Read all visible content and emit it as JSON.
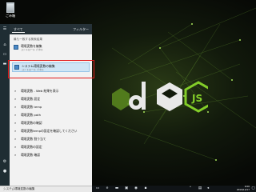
{
  "desktop": {
    "recycle_bin_label": "ごみ箱"
  },
  "search_panel": {
    "tabs": {
      "all": "すべて",
      "filter": "フィルター"
    },
    "section_best": "最も一致する検索結果",
    "best_match": [
      {
        "title": "環境変数を編集",
        "subtitle": "コントロール パネル"
      },
      {
        "title": "システム環境変数の編集",
        "subtitle": "コントロール パネル"
      }
    ],
    "suggestions": [
      {
        "text": "環境変数 - Web 結果を表示"
      },
      {
        "text": "環境変数 設定"
      },
      {
        "text": "環境変数 temp"
      },
      {
        "text": "環境変数 path"
      },
      {
        "text": "環境変数の確認"
      },
      {
        "text": "環境変数tempの設定を確認してください"
      },
      {
        "text": "環境変数 割り当て"
      },
      {
        "text": "環境変数の設定"
      },
      {
        "text": "環境変数 確認"
      }
    ],
    "search_query": "システム環境変数の編集"
  },
  "taskbar": {
    "time": "9:00",
    "date": "2019/12/17"
  },
  "colors": {
    "accent": "#e21b1b",
    "selection": "#cfe5f5",
    "node_green": "#83cd29"
  }
}
